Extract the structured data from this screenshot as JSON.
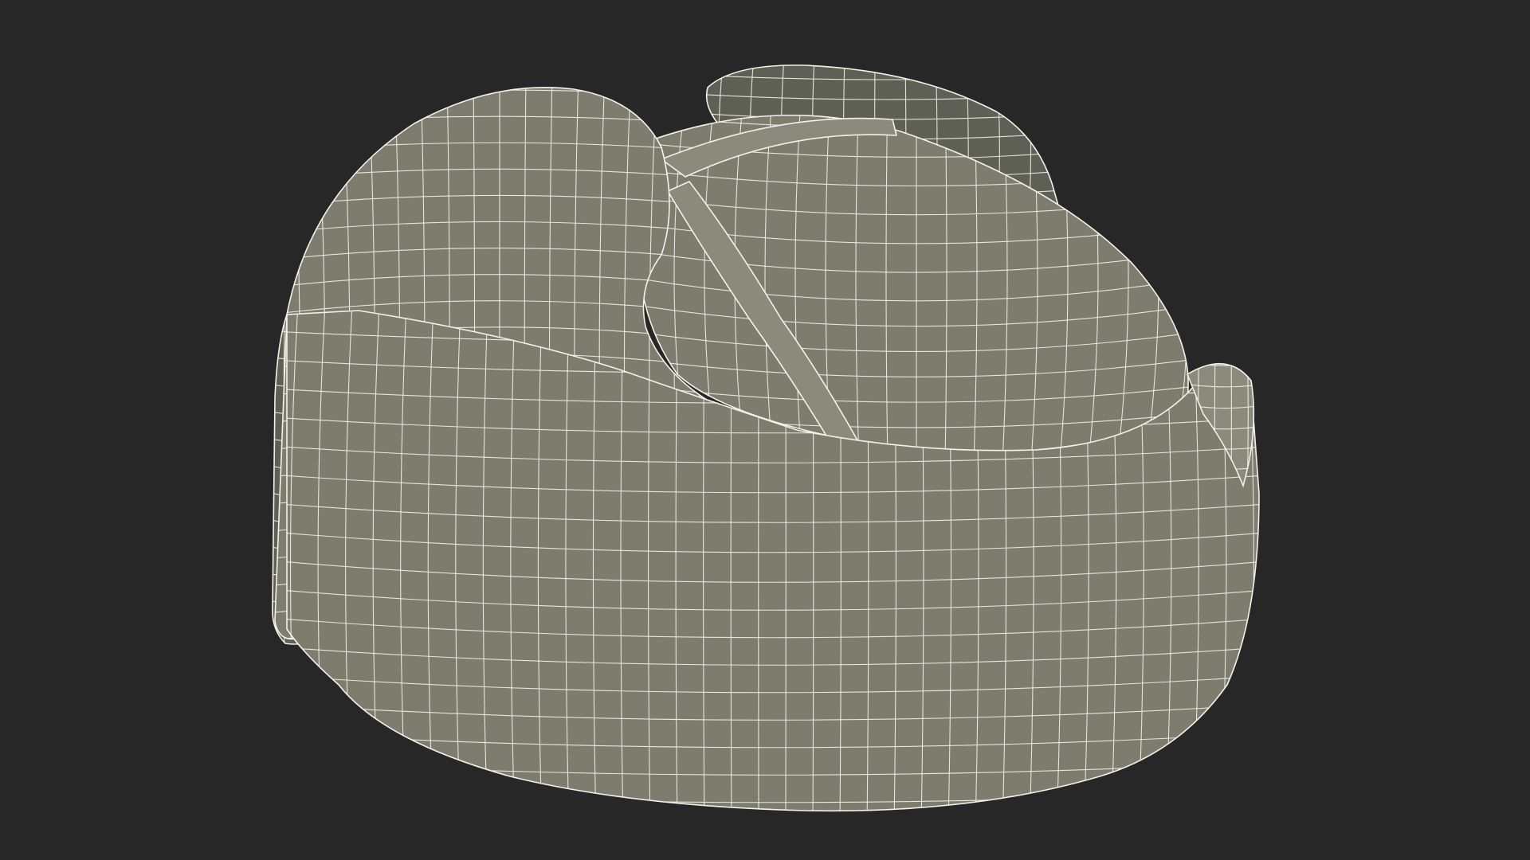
{
  "scene": {
    "subject": "wireframe-hat-model",
    "background_color": "#272727",
    "surface_color": "#7c7d6f",
    "surface_shadow_color": "#5f6055",
    "surface_light_color": "#8a8b7d",
    "wire_color": "#f2f2ea"
  }
}
